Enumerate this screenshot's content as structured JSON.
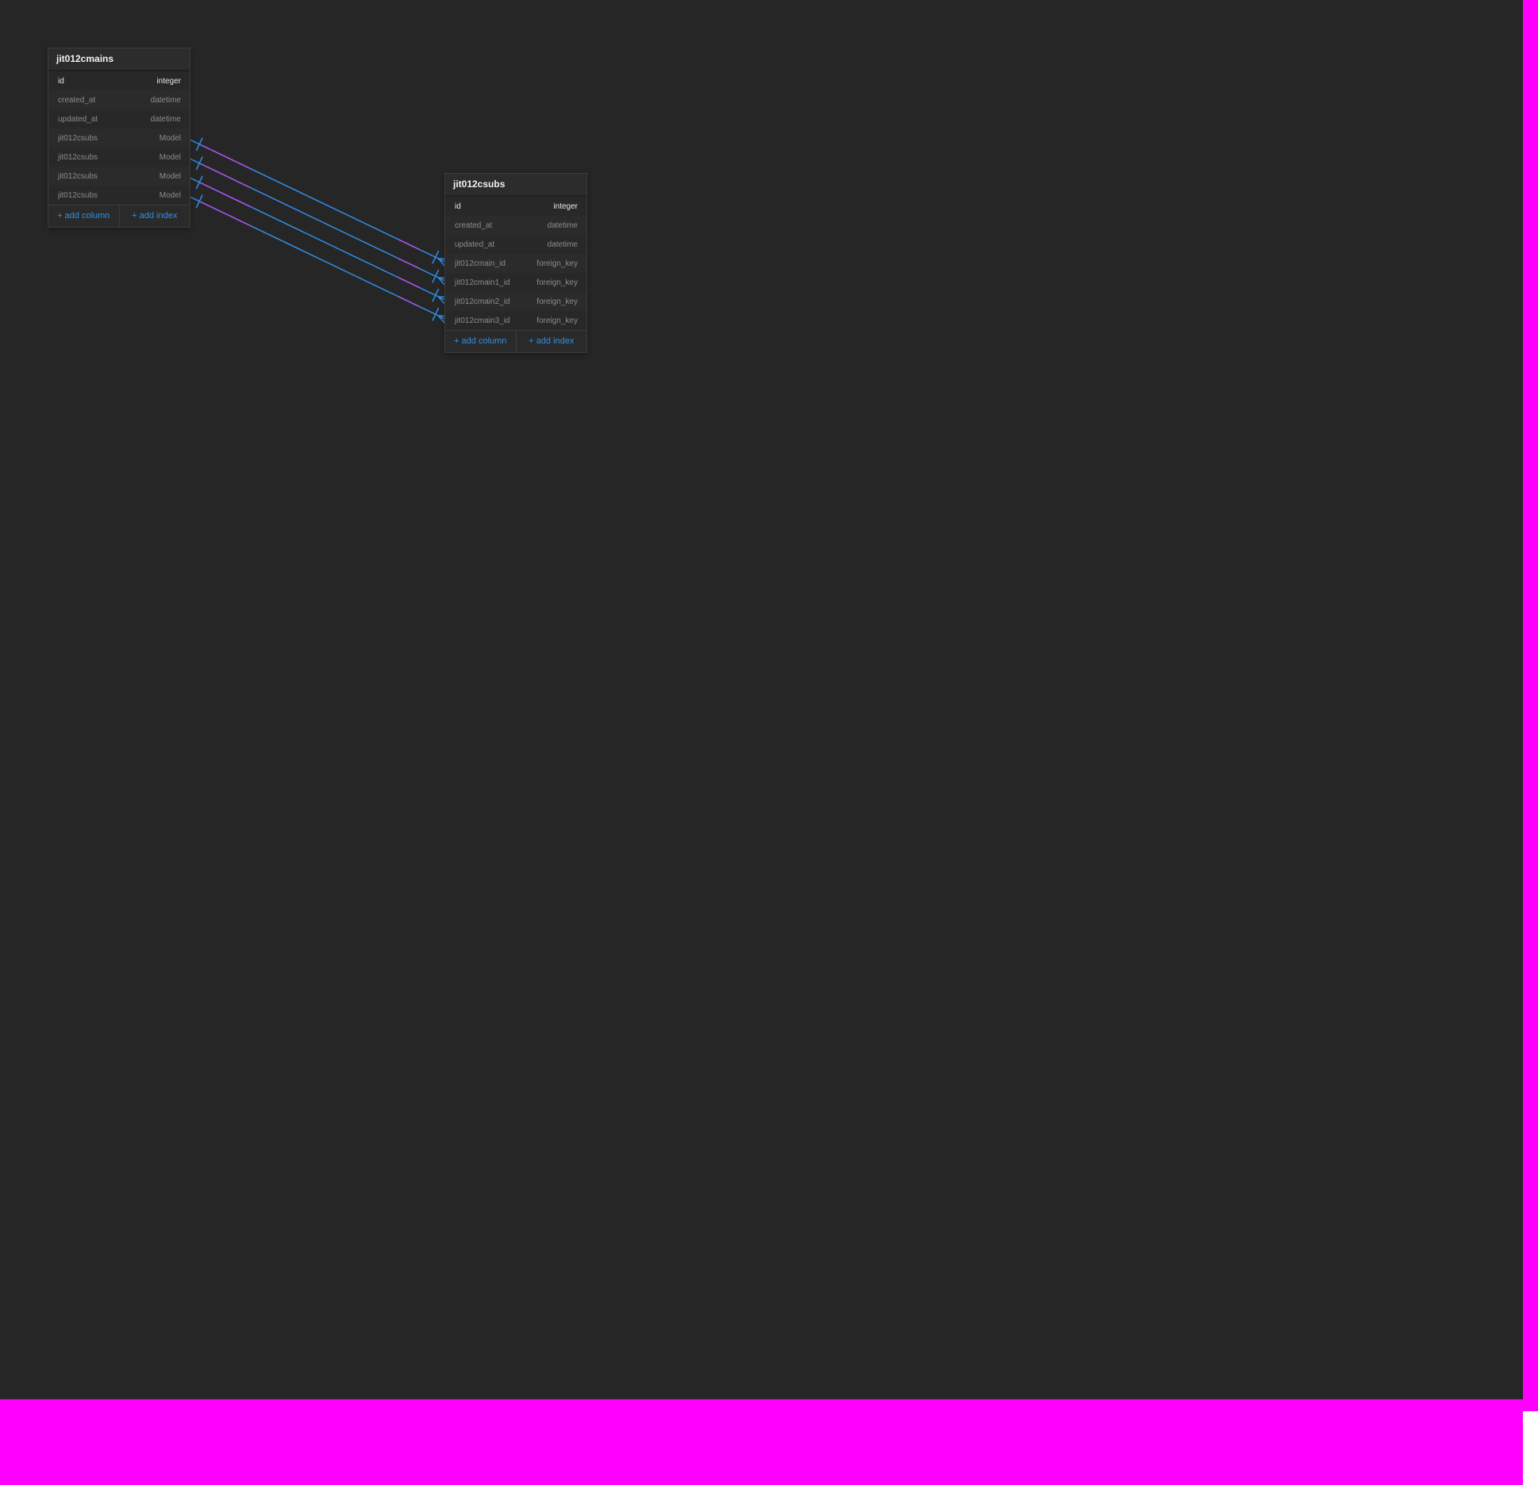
{
  "tables": [
    {
      "name": "jit012cmains",
      "columns": [
        {
          "name": "id",
          "type": "integer",
          "primary": true
        },
        {
          "name": "created_at",
          "type": "datetime"
        },
        {
          "name": "updated_at",
          "type": "datetime"
        },
        {
          "name": "jit012csubs",
          "type": "Model"
        },
        {
          "name": "jit012csubs",
          "type": "Model"
        },
        {
          "name": "jit012csubs",
          "type": "Model"
        },
        {
          "name": "jit012csubs",
          "type": "Model"
        }
      ],
      "add_column_label": "+ add column",
      "add_index_label": "+ add index"
    },
    {
      "name": "jit012csubs",
      "columns": [
        {
          "name": "id",
          "type": "integer",
          "primary": true
        },
        {
          "name": "created_at",
          "type": "datetime"
        },
        {
          "name": "updated_at",
          "type": "datetime"
        },
        {
          "name": "jit012cmain_id",
          "type": "foreign_key"
        },
        {
          "name": "jit012cmain1_id",
          "type": "foreign_key"
        },
        {
          "name": "jit012cmain2_id",
          "type": "foreign_key"
        },
        {
          "name": "jit012cmain3_id",
          "type": "foreign_key"
        }
      ],
      "add_column_label": "+ add column",
      "add_index_label": "+ add index"
    }
  ],
  "relations": [
    {
      "from_table": "jit012cmains",
      "from_column": 3,
      "to_table": "jit012csubs",
      "to_column": 3
    },
    {
      "from_table": "jit012cmains",
      "from_column": 4,
      "to_table": "jit012csubs",
      "to_column": 4
    },
    {
      "from_table": "jit012cmains",
      "from_column": 5,
      "to_table": "jit012csubs",
      "to_column": 5
    },
    {
      "from_table": "jit012cmains",
      "from_column": 6,
      "to_table": "jit012csubs",
      "to_column": 6
    }
  ],
  "colors": {
    "canvas": "#262626",
    "relation_line": "#2f8fe8",
    "relation_highlight": "#b44fe8",
    "link": "#2f8fe8"
  }
}
